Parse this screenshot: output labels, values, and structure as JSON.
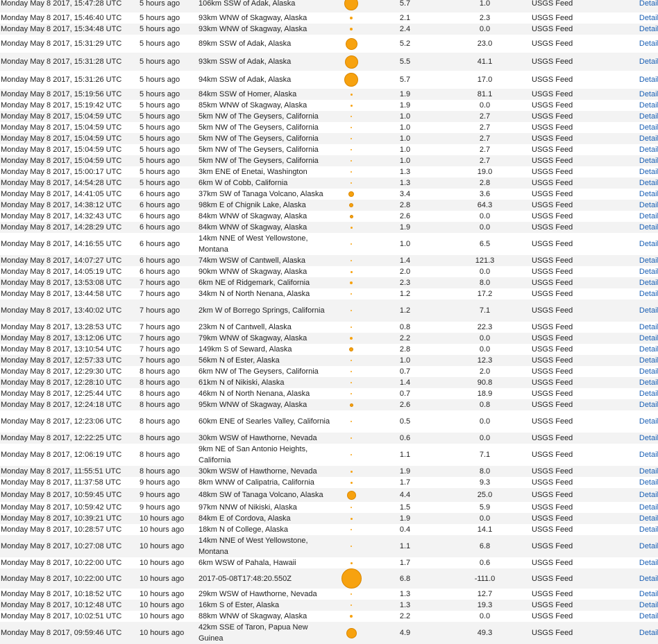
{
  "link_label": "Detail",
  "source_label": "USGS Feed",
  "marker_color": "#f7a20f",
  "rows": [
    {
      "time": "Monday May 8 2017, 15:47:28 UTC",
      "ago": "5 hours ago",
      "place": "106km SSW of Adak, Alaska",
      "mag": "5.7",
      "depth": "1.0"
    },
    {
      "time": "Monday May 8 2017, 15:46:40 UTC",
      "ago": "5 hours ago",
      "place": "93km WNW of Skagway, Alaska",
      "mag": "2.1",
      "depth": "2.3"
    },
    {
      "time": "Monday May 8 2017, 15:34:48 UTC",
      "ago": "5 hours ago",
      "place": "93km WNW of Skagway, Alaska",
      "mag": "2.4",
      "depth": "0.0"
    },
    {
      "time": "Monday May 8 2017, 15:31:29 UTC",
      "ago": "5 hours ago",
      "place": "89km SSW of Adak, Alaska",
      "mag": "5.2",
      "depth": "23.0"
    },
    {
      "time": "Monday May 8 2017, 15:31:28 UTC",
      "ago": "5 hours ago",
      "place": "93km SSW of Adak, Alaska",
      "mag": "5.5",
      "depth": "41.1"
    },
    {
      "time": "Monday May 8 2017, 15:31:26 UTC",
      "ago": "5 hours ago",
      "place": "94km SSW of Adak, Alaska",
      "mag": "5.7",
      "depth": "17.0"
    },
    {
      "time": "Monday May 8 2017, 15:19:56 UTC",
      "ago": "5 hours ago",
      "place": "84km SSW of Homer, Alaska",
      "mag": "1.9",
      "depth": "81.1"
    },
    {
      "time": "Monday May 8 2017, 15:19:42 UTC",
      "ago": "5 hours ago",
      "place": "85km WNW of Skagway, Alaska",
      "mag": "1.9",
      "depth": "0.0"
    },
    {
      "time": "Monday May 8 2017, 15:04:59 UTC",
      "ago": "5 hours ago",
      "place": "5km NW of The Geysers, California",
      "mag": "1.0",
      "depth": "2.7"
    },
    {
      "time": "Monday May 8 2017, 15:04:59 UTC",
      "ago": "5 hours ago",
      "place": "5km NW of The Geysers, California",
      "mag": "1.0",
      "depth": "2.7"
    },
    {
      "time": "Monday May 8 2017, 15:04:59 UTC",
      "ago": "5 hours ago",
      "place": "5km NW of The Geysers, California",
      "mag": "1.0",
      "depth": "2.7"
    },
    {
      "time": "Monday May 8 2017, 15:04:59 UTC",
      "ago": "5 hours ago",
      "place": "5km NW of The Geysers, California",
      "mag": "1.0",
      "depth": "2.7"
    },
    {
      "time": "Monday May 8 2017, 15:04:59 UTC",
      "ago": "5 hours ago",
      "place": "5km NW of The Geysers, California",
      "mag": "1.0",
      "depth": "2.7"
    },
    {
      "time": "Monday May 8 2017, 15:00:17 UTC",
      "ago": "5 hours ago",
      "place": "3km ENE of Enetai, Washington",
      "mag": "1.3",
      "depth": "19.0"
    },
    {
      "time": "Monday May 8 2017, 14:54:28 UTC",
      "ago": "5 hours ago",
      "place": "6km W of Cobb, California",
      "mag": "1.3",
      "depth": "2.8"
    },
    {
      "time": "Monday May 8 2017, 14:41:05 UTC",
      "ago": "6 hours ago",
      "place": "37km SW of Tanaga Volcano, Alaska",
      "mag": "3.4",
      "depth": "3.6"
    },
    {
      "time": "Monday May 8 2017, 14:38:12 UTC",
      "ago": "6 hours ago",
      "place": "98km E of Chignik Lake, Alaska",
      "mag": "2.8",
      "depth": "64.3"
    },
    {
      "time": "Monday May 8 2017, 14:32:43 UTC",
      "ago": "6 hours ago",
      "place": "84km WNW of Skagway, Alaska",
      "mag": "2.6",
      "depth": "0.0"
    },
    {
      "time": "Monday May 8 2017, 14:28:29 UTC",
      "ago": "6 hours ago",
      "place": "84km WNW of Skagway, Alaska",
      "mag": "1.9",
      "depth": "0.0"
    },
    {
      "time": "Monday May 8 2017, 14:16:55 UTC",
      "ago": "6 hours ago",
      "place": "14km NNE of West Yellowstone, Montana",
      "mag": "1.0",
      "depth": "6.5"
    },
    {
      "time": "Monday May 8 2017, 14:07:27 UTC",
      "ago": "6 hours ago",
      "place": "74km WSW of Cantwell, Alaska",
      "mag": "1.4",
      "depth": "121.3"
    },
    {
      "time": "Monday May 8 2017, 14:05:19 UTC",
      "ago": "6 hours ago",
      "place": "90km WNW of Skagway, Alaska",
      "mag": "2.0",
      "depth": "0.0"
    },
    {
      "time": "Monday May 8 2017, 13:53:08 UTC",
      "ago": "7 hours ago",
      "place": "6km NE of Ridgemark, California",
      "mag": "2.3",
      "depth": "8.0"
    },
    {
      "time": "Monday May 8 2017, 13:44:58 UTC",
      "ago": "7 hours ago",
      "place": "34km N of North Nenana, Alaska",
      "mag": "1.2",
      "depth": "17.2"
    },
    {
      "time": "Monday May 8 2017, 13:40:02 UTC",
      "ago": "7 hours ago",
      "place": "2km W of Borrego Springs, California",
      "mag": "1.2",
      "depth": "7.1"
    },
    {
      "time": "Monday May 8 2017, 13:28:53 UTC",
      "ago": "7 hours ago",
      "place": "23km N of Cantwell, Alaska",
      "mag": "0.8",
      "depth": "22.3"
    },
    {
      "time": "Monday May 8 2017, 13:12:06 UTC",
      "ago": "7 hours ago",
      "place": "79km WNW of Skagway, Alaska",
      "mag": "2.2",
      "depth": "0.0"
    },
    {
      "time": "Monday May 8 2017, 13:10:54 UTC",
      "ago": "7 hours ago",
      "place": "149km S of Seward, Alaska",
      "mag": "2.8",
      "depth": "0.0"
    },
    {
      "time": "Monday May 8 2017, 12:57:33 UTC",
      "ago": "7 hours ago",
      "place": "56km N of Ester, Alaska",
      "mag": "1.0",
      "depth": "12.3"
    },
    {
      "time": "Monday May 8 2017, 12:29:30 UTC",
      "ago": "8 hours ago",
      "place": "6km NW of The Geysers, California",
      "mag": "0.7",
      "depth": "2.0"
    },
    {
      "time": "Monday May 8 2017, 12:28:10 UTC",
      "ago": "8 hours ago",
      "place": "61km N of Nikiski, Alaska",
      "mag": "1.4",
      "depth": "90.8"
    },
    {
      "time": "Monday May 8 2017, 12:25:44 UTC",
      "ago": "8 hours ago",
      "place": "46km N of North Nenana, Alaska",
      "mag": "0.7",
      "depth": "18.9"
    },
    {
      "time": "Monday May 8 2017, 12:24:18 UTC",
      "ago": "8 hours ago",
      "place": "95km WNW of Skagway, Alaska",
      "mag": "2.6",
      "depth": "0.8"
    },
    {
      "time": "Monday May 8 2017, 12:23:06 UTC",
      "ago": "8 hours ago",
      "place": "60km ENE of Searles Valley, California",
      "mag": "0.5",
      "depth": "0.0"
    },
    {
      "time": "Monday May 8 2017, 12:22:25 UTC",
      "ago": "8 hours ago",
      "place": "30km WSW of Hawthorne, Nevada",
      "mag": "0.6",
      "depth": "0.0"
    },
    {
      "time": "Monday May 8 2017, 12:06:19 UTC",
      "ago": "8 hours ago",
      "place": "9km NE of San Antonio Heights, California",
      "mag": "1.1",
      "depth": "7.1"
    },
    {
      "time": "Monday May 8 2017, 11:55:51 UTC",
      "ago": "8 hours ago",
      "place": "30km WSW of Hawthorne, Nevada",
      "mag": "1.9",
      "depth": "8.0"
    },
    {
      "time": "Monday May 8 2017, 11:37:58 UTC",
      "ago": "9 hours ago",
      "place": "8km WNW of Calipatria, California",
      "mag": "1.7",
      "depth": "9.3"
    },
    {
      "time": "Monday May 8 2017, 10:59:45 UTC",
      "ago": "9 hours ago",
      "place": "48km SW of Tanaga Volcano, Alaska",
      "mag": "4.4",
      "depth": "25.0"
    },
    {
      "time": "Monday May 8 2017, 10:59:42 UTC",
      "ago": "9 hours ago",
      "place": "97km NNW of Nikiski, Alaska",
      "mag": "1.5",
      "depth": "5.9"
    },
    {
      "time": "Monday May 8 2017, 10:39:21 UTC",
      "ago": "10 hours ago",
      "place": "84km E of Cordova, Alaska",
      "mag": "1.9",
      "depth": "0.0"
    },
    {
      "time": "Monday May 8 2017, 10:28:57 UTC",
      "ago": "10 hours ago",
      "place": "18km N of College, Alaska",
      "mag": "0.4",
      "depth": "14.1"
    },
    {
      "time": "Monday May 8 2017, 10:27:08 UTC",
      "ago": "10 hours ago",
      "place": "14km NNE of West Yellowstone, Montana",
      "mag": "1.1",
      "depth": "6.8"
    },
    {
      "time": "Monday May 8 2017, 10:22:00 UTC",
      "ago": "10 hours ago",
      "place": "6km WSW of Pahala, Hawaii",
      "mag": "1.7",
      "depth": "0.6"
    },
    {
      "time": "Monday May 8 2017, 10:22:00 UTC",
      "ago": "10 hours ago",
      "place": "2017-05-08T17:48:20.550Z",
      "mag": "6.8",
      "depth": "-111.0"
    },
    {
      "time": "Monday May 8 2017, 10:18:52 UTC",
      "ago": "10 hours ago",
      "place": "29km WSW of Hawthorne, Nevada",
      "mag": "1.3",
      "depth": "12.7"
    },
    {
      "time": "Monday May 8 2017, 10:12:48 UTC",
      "ago": "10 hours ago",
      "place": "16km S of Ester, Alaska",
      "mag": "1.3",
      "depth": "19.3"
    },
    {
      "time": "Monday May 8 2017, 10:02:51 UTC",
      "ago": "10 hours ago",
      "place": "88km WNW of Skagway, Alaska",
      "mag": "2.2",
      "depth": "0.0"
    },
    {
      "time": "Monday May 8 2017, 09:59:46 UTC",
      "ago": "10 hours ago",
      "place": "42km SSE of Taron, Papua New Guinea",
      "mag": "4.9",
      "depth": "49.3"
    }
  ]
}
